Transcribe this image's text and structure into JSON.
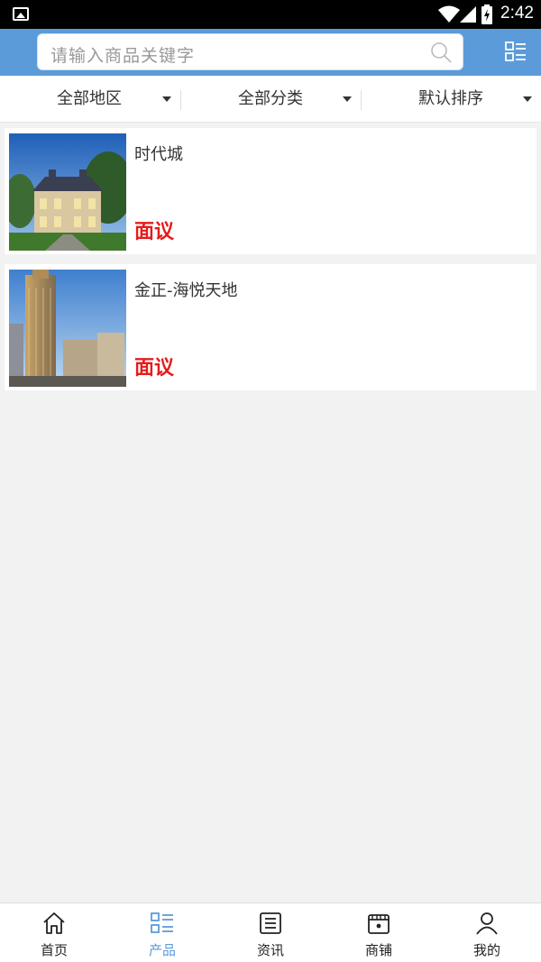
{
  "status_bar": {
    "time": "2:42"
  },
  "search": {
    "placeholder": "请输入商品关键字"
  },
  "filters": [
    {
      "label": "全部地区"
    },
    {
      "label": "全部分类"
    },
    {
      "label": "默认排序"
    }
  ],
  "products": [
    {
      "title": "时代城",
      "price": "面议"
    },
    {
      "title": "金正-海悦天地",
      "price": "面议"
    }
  ],
  "tabs": [
    {
      "label": "首页",
      "icon": "home-icon",
      "active": false
    },
    {
      "label": "产品",
      "icon": "product-list-icon",
      "active": true
    },
    {
      "label": "资讯",
      "icon": "news-icon",
      "active": false
    },
    {
      "label": "商铺",
      "icon": "shop-icon",
      "active": false
    },
    {
      "label": "我的",
      "icon": "user-icon",
      "active": false
    }
  ],
  "colors": {
    "accent": "#5b9bd9",
    "price": "#e51c1c",
    "background": "#f2f2f2"
  }
}
